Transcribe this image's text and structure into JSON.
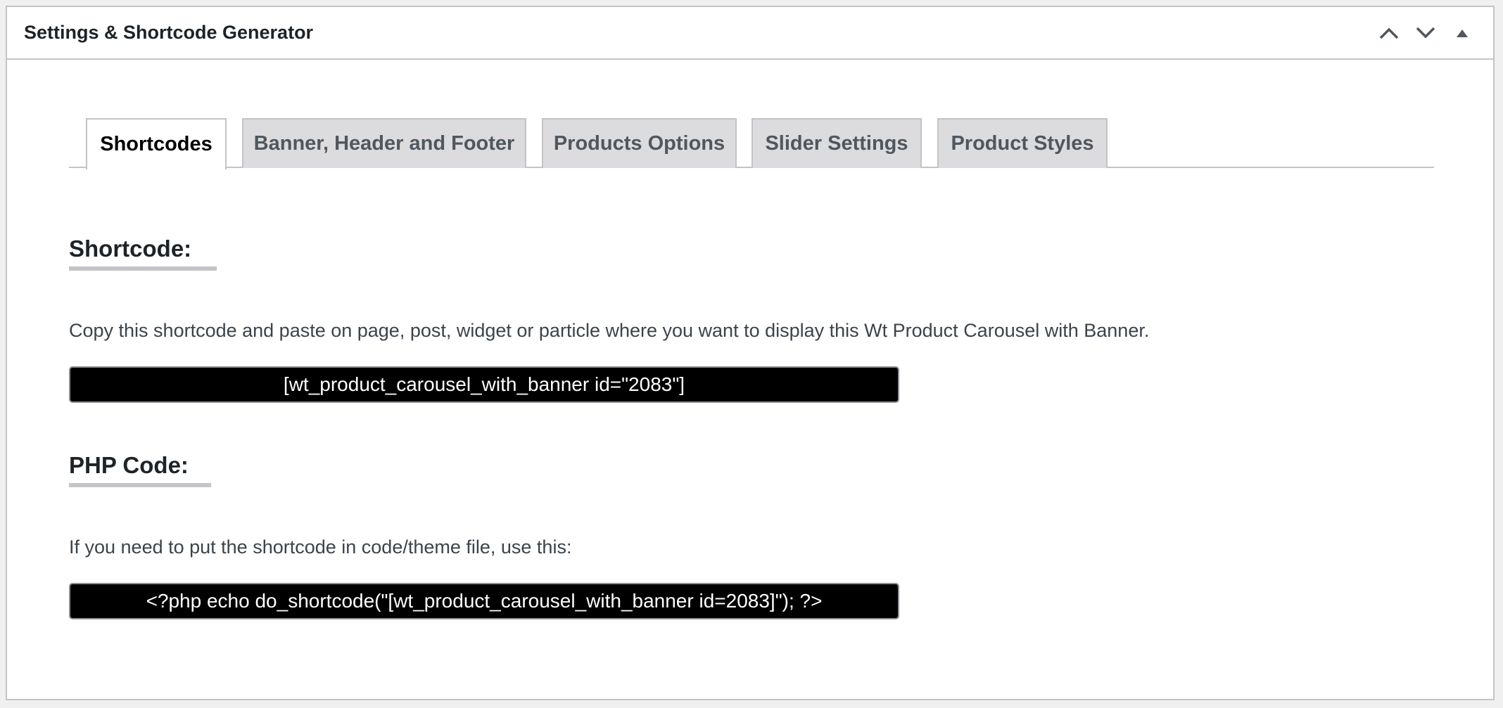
{
  "header": {
    "title": "Settings & Shortcode Generator",
    "actions": [
      {
        "icon": "chevron-up-icon"
      },
      {
        "icon": "chevron-down-icon"
      },
      {
        "icon": "triangle-up-icon"
      }
    ]
  },
  "tabs": [
    {
      "label": "Shortcodes",
      "active": true
    },
    {
      "label": "Banner, Header and Footer",
      "active": false
    },
    {
      "label": "Products Options",
      "active": false
    },
    {
      "label": "Slider Settings",
      "active": false
    },
    {
      "label": "Product Styles",
      "active": false
    }
  ],
  "shortcode": {
    "heading": "Shortcode:",
    "description": "Copy this shortcode and paste on page, post, widget or particle where you want to display this Wt Product Carousel with Banner.",
    "value": "[wt_product_carousel_with_banner id=\"2083\"]"
  },
  "php": {
    "heading": "PHP Code:",
    "description": "If you need to put the shortcode in code/theme file, use this:",
    "value": "<?php echo do_shortcode(\"[wt_product_carousel_with_banner id=2083]\"); ?>"
  },
  "colors": {
    "code_background": "#000000",
    "code_text": "#ffffff",
    "border": "#c3c4c7",
    "inactive_tab": "#dcdcde"
  }
}
